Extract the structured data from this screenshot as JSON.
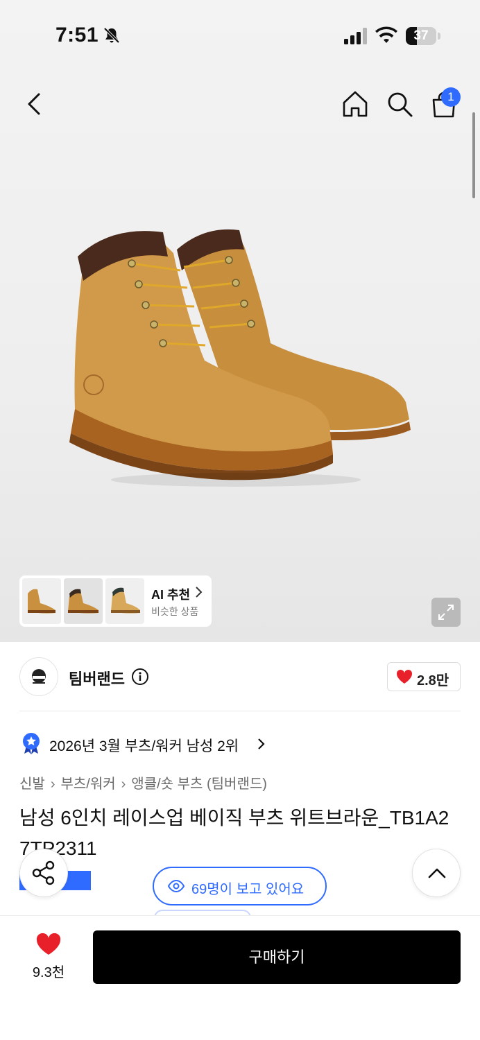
{
  "status_bar": {
    "time": "7:51",
    "battery": "37",
    "battery_level": 0.37
  },
  "nav": {
    "cart_count": "1"
  },
  "gallery": {
    "ai_title": "AI 추천",
    "ai_subtitle": "비슷한 상품",
    "thumbnails": [
      "boot-thumb-1",
      "boot-thumb-2",
      "boot-thumb-3"
    ]
  },
  "brand": {
    "name": "팀버랜드",
    "like_count": "2.8만"
  },
  "ranking": {
    "text": "2026년 3월 부츠/워커 남성 2위"
  },
  "breadcrumb": [
    "신발",
    "부츠/워커",
    "앵클/숏 부츠 (팀버랜드)"
  ],
  "product": {
    "title": "남성 6인치 레이스업 베이직 부츠 위트브라운_TB1A27TP2311",
    "tag": "스타"
  },
  "viewers": {
    "text": "69명이 보고 있어요"
  },
  "bottom": {
    "wish_count": "9.3천",
    "buy_label": "구매하기"
  },
  "colors": {
    "accent": "#2f6bff",
    "heart": "#e8202a",
    "buy_bg": "#000000"
  }
}
